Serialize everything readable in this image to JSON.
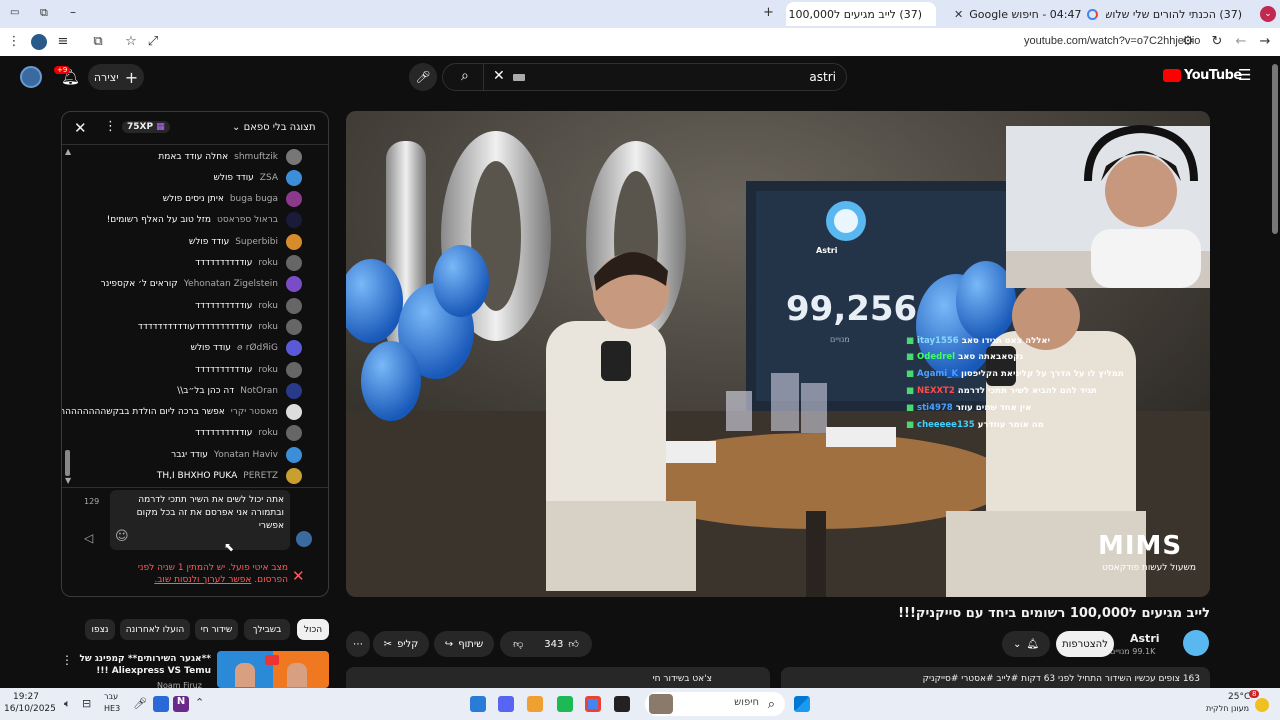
{
  "browser": {
    "tabs": [
      {
        "title": "(37) הכנתי להורים שלי שלוש מ...",
        "close": "✕"
      },
      {
        "title": "04:47 - חיפוש Google",
        "close": "✕"
      },
      {
        "title": "(37) לייב מגיעים ל100,000 ר...",
        "close": "✕"
      }
    ],
    "new_tab": "+",
    "url": "youtube.com/watch?v=o7C2hhjeUio"
  },
  "youtube": {
    "logo": "YouTube",
    "search_value": "astri",
    "create_label": "יצירה",
    "notif_badge": "+9",
    "chat": {
      "header_title": "תצוגה בלי ספאם",
      "xp_badge": "75XP",
      "messages": [
        {
          "author": "shmuftzik",
          "text": "אחלה עודד באמת",
          "color": "#777"
        },
        {
          "author": "ZSA",
          "text": "עודד פולש",
          "color": "#3d8ed8"
        },
        {
          "author": "buga buga",
          "text": "איתן ניסים פולש",
          "color": "#8b3a8b"
        },
        {
          "author": "בראול ספראסט",
          "text": "מזל טוב על האלף רשומים!",
          "color": "#1a1a3a"
        },
        {
          "author": "Superbibi",
          "text": "עודד פולש",
          "color": "#d88b2a"
        },
        {
          "author": "roku",
          "text": "עודדדדדדדדדד",
          "color": "#666"
        },
        {
          "author": "Yehonatan Zigelstein",
          "text": "קוראים ל׳ אקספינר",
          "color": "#7b4cc7"
        },
        {
          "author": "roku",
          "text": "עודדדדדדדדדד",
          "color": "#666"
        },
        {
          "author": "roku",
          "text": "עודדדדדדדדדדעודדדדדדדדדד",
          "color": "#666"
        },
        {
          "author": "ꪮ rØdЯiG",
          "text": "עודד פולש",
          "color": "#5a5ad8"
        },
        {
          "author": "roku",
          "text": "עודדדדדדדדדד",
          "color": "#666"
        },
        {
          "author": "NotOran",
          "text": "דה כהן בל״ב\\\\",
          "color": "#2a3a8b"
        },
        {
          "author": "מאסטר יקרי",
          "text": "אפשר ברכה ליום הולדת בבקשהההההההההההה",
          "color": "#ddd"
        },
        {
          "author": "roku",
          "text": "עודדדדדדדדדד",
          "color": "#666"
        },
        {
          "author": "Yonatan Haviv",
          "text": "עודד יגבר",
          "color": "#3d8ed8"
        },
        {
          "author": "PERETZ",
          "text": "TH,I BHXHO PUKA",
          "color": "#c8a030"
        }
      ],
      "char_count": "129",
      "input_text": "אתה יכול לשים את השיר תתכי לדרמה ובתמורה אני אפרסם את זה בכל מקום אפשרי",
      "notice_text": "מצב איטי פועל. יש להמתין 1 שניה לפני הפרסום.",
      "notice_link": "אפשר לערוך ולנסות שוב."
    },
    "chips": [
      "הכול",
      "בשבילך",
      "שידור חי",
      "הועלו לאחרונה",
      "נצפו"
    ],
    "recommended": {
      "title": "**אגער השירותים** קמפינג של Aliexpress VS Temu !!!",
      "channel": "Noam Firuz"
    },
    "video": {
      "title": "לייב מגיעים ל100,000 רשומים ביחד עם סייקניק!!!",
      "counter_name": "Astri",
      "counter_value": "99,256",
      "counter_label": "מנויים",
      "watermark_top": "MIMS",
      "watermark_sub": "משעול לעשות פודקאסט",
      "overlay_chat": [
        {
          "user": "itay1556",
          "text": "יאללה צאט תגידו סאב"
        },
        {
          "user": "Odedrel",
          "text": "נקסאבאתה סאב"
        },
        {
          "user": "Agami_K",
          "text": "תמליץ לו על הדרך על קליניאת הקליפסון"
        },
        {
          "user": "NEXXT2",
          "text": "תגיד להם להביא לשיר תתכי לדרמה"
        },
        {
          "user": "sti4978",
          "text": "אין אחד שמים עוזר"
        },
        {
          "user": "cheeeee135",
          "text": "מה אומר עוזדרע"
        }
      ]
    },
    "channel": {
      "name": "Astri",
      "subs": "99.1K מנויים",
      "join_label": "להצטרפות"
    },
    "actions": {
      "likes": "343",
      "share": "שיתוף",
      "clip": "קליפ",
      "more": "⋯"
    },
    "description": {
      "stats": "163 צופים עכשיו  השידור התחיל לפני 63 דקות  #לייב #אסטרי #סייקניק",
      "live_chat_replay": "צ'אט בשידור חי"
    }
  },
  "taskbar": {
    "time": "19:27",
    "date": "16/10/2025",
    "lang": "עבר",
    "lang_sub": "HE3",
    "search_placeholder": "חיפוש",
    "weather_temp": "25°C",
    "weather_desc": "מעונן חלקית",
    "notif_count": "8"
  }
}
